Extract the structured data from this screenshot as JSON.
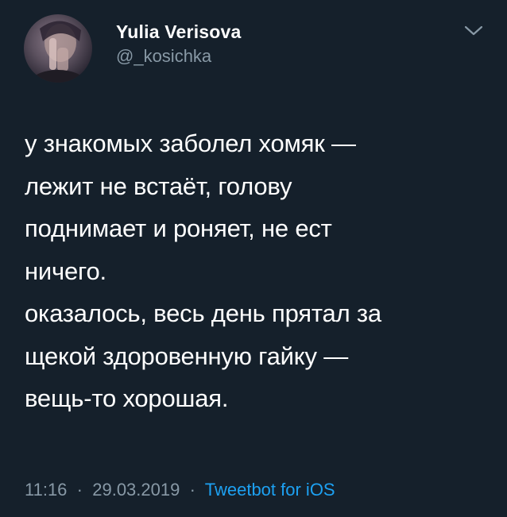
{
  "author": {
    "display_name": "Yulia Verisova",
    "handle": "@_kosichka"
  },
  "tweet": {
    "lines": [
      "у знакомых заболел хомяк —",
      "лежит не встаёт, голову",
      "поднимает и роняет, не ест",
      "ничего.",
      "оказалось, весь день прятал за",
      "щекой здоровенную гайку —",
      "вещь-то хорошая."
    ]
  },
  "meta": {
    "time": "11:16",
    "separator": "·",
    "date": "29.03.2019",
    "source": "Tweetbot for iOS"
  },
  "icons": {
    "menu": "chevron-down-icon",
    "avatar": "avatar"
  },
  "colors": {
    "background": "#15202b",
    "text": "#ffffff",
    "secondary": "#8899a6",
    "link": "#1da1f2"
  }
}
